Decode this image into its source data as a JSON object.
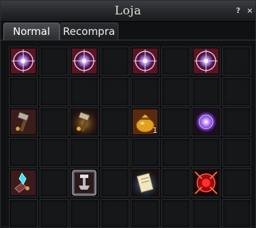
{
  "window": {
    "title": "Loja",
    "help_label": "?",
    "close_label": "×"
  },
  "tabs": [
    {
      "label": "Normal",
      "active": true
    },
    {
      "label": "Recompra",
      "active": false
    }
  ],
  "grid": {
    "columns": 8,
    "rows": 6,
    "slots": [
      {
        "icon": "purple-seal-icon",
        "qty": ""
      },
      {
        "icon": "",
        "qty": ""
      },
      {
        "icon": "purple-seal-icon",
        "qty": ""
      },
      {
        "icon": "",
        "qty": ""
      },
      {
        "icon": "purple-seal-icon",
        "qty": ""
      },
      {
        "icon": "",
        "qty": ""
      },
      {
        "icon": "purple-seal-icon",
        "qty": ""
      },
      {
        "icon": "",
        "qty": ""
      },
      {
        "icon": "",
        "qty": ""
      },
      {
        "icon": "",
        "qty": ""
      },
      {
        "icon": "",
        "qty": ""
      },
      {
        "icon": "",
        "qty": ""
      },
      {
        "icon": "",
        "qty": ""
      },
      {
        "icon": "",
        "qty": ""
      },
      {
        "icon": "",
        "qty": ""
      },
      {
        "icon": "",
        "qty": ""
      },
      {
        "icon": "hammer-icon",
        "qty": ""
      },
      {
        "icon": "",
        "qty": ""
      },
      {
        "icon": "hammer-glowing-icon",
        "qty": ""
      },
      {
        "icon": "",
        "qty": ""
      },
      {
        "icon": "gold-pouch-icon",
        "qty": "1"
      },
      {
        "icon": "",
        "qty": ""
      },
      {
        "icon": "purple-orb-icon",
        "qty": ""
      },
      {
        "icon": "",
        "qty": ""
      },
      {
        "icon": "",
        "qty": ""
      },
      {
        "icon": "",
        "qty": ""
      },
      {
        "icon": "",
        "qty": ""
      },
      {
        "icon": "",
        "qty": ""
      },
      {
        "icon": "",
        "qty": ""
      },
      {
        "icon": "",
        "qty": ""
      },
      {
        "icon": "",
        "qty": ""
      },
      {
        "icon": "",
        "qty": ""
      },
      {
        "icon": "crystal-gauntlet-icon",
        "qty": ""
      },
      {
        "icon": "",
        "qty": ""
      },
      {
        "icon": "anvil-card-icon",
        "qty": ""
      },
      {
        "icon": "",
        "qty": ""
      },
      {
        "icon": "glowing-scroll-icon",
        "qty": ""
      },
      {
        "icon": "",
        "qty": ""
      },
      {
        "icon": "red-rune-icon",
        "qty": ""
      },
      {
        "icon": "",
        "qty": ""
      },
      {
        "icon": "",
        "qty": ""
      },
      {
        "icon": "",
        "qty": ""
      },
      {
        "icon": "",
        "qty": ""
      },
      {
        "icon": "",
        "qty": ""
      },
      {
        "icon": "",
        "qty": ""
      },
      {
        "icon": "",
        "qty": ""
      },
      {
        "icon": "",
        "qty": ""
      },
      {
        "icon": "",
        "qty": ""
      }
    ]
  }
}
